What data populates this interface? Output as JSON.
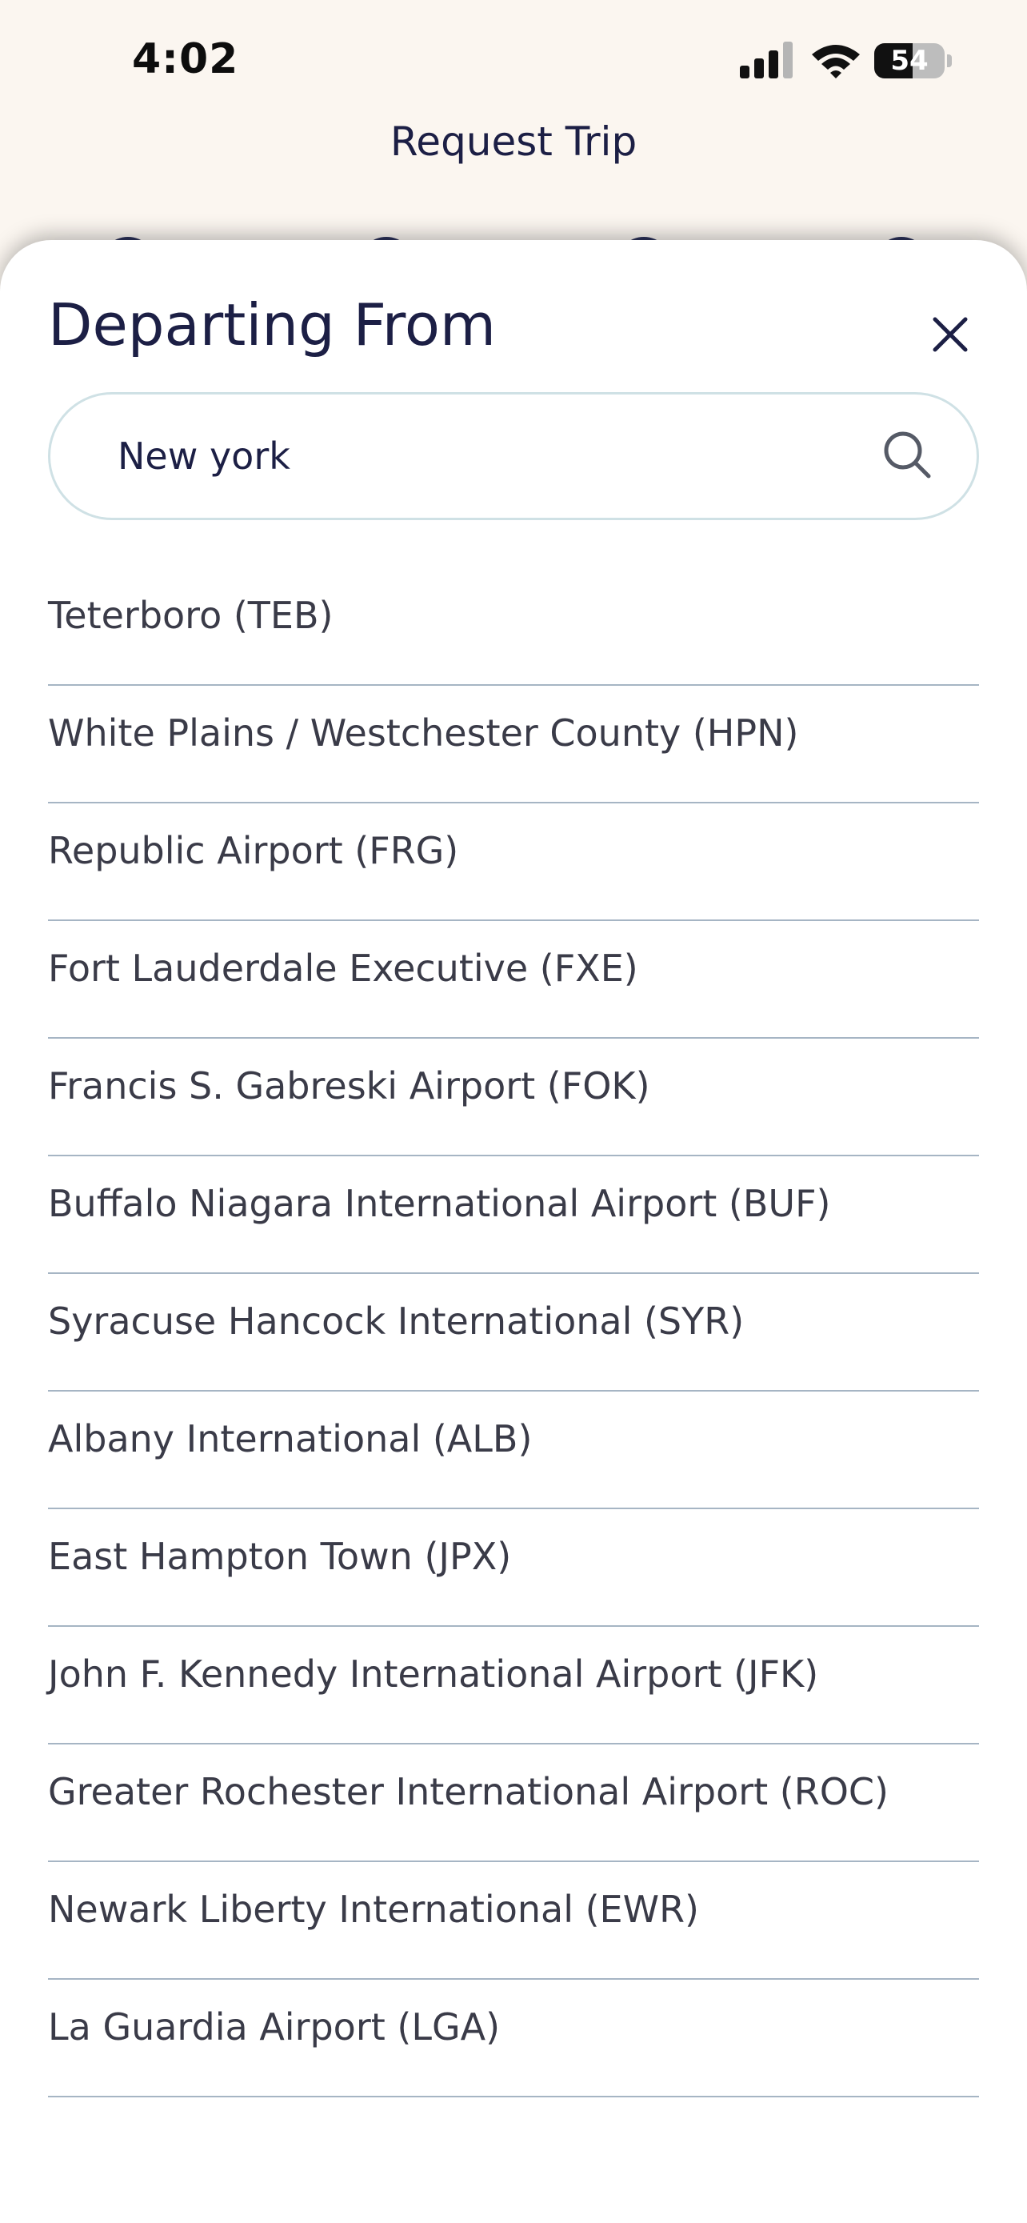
{
  "status_bar": {
    "time": "4:02",
    "battery_level": "54",
    "battery_fraction": 0.54,
    "icons": [
      "cellular-signal-icon",
      "wifi-icon",
      "battery-icon"
    ]
  },
  "page": {
    "title": "Request Trip"
  },
  "sheet": {
    "title": "Departing From",
    "close_icon": "close-icon",
    "search": {
      "value": "New york",
      "icon": "search-icon"
    },
    "results": [
      "Teterboro (TEB)",
      "White Plains / Westchester County (HPN)",
      "Republic Airport (FRG)",
      "Fort Lauderdale Executive (FXE)",
      "Francis S. Gabreski Airport (FOK)",
      "Buffalo Niagara International Airport (BUF)",
      "Syracuse Hancock International (SYR)",
      "Albany International (ALB)",
      "East Hampton Town (JPX)",
      "John F. Kennedy International Airport (JFK)",
      "Greater Rochester International Airport (ROC)",
      "Newark Liberty International (EWR)",
      "La Guardia Airport (LGA)"
    ]
  },
  "colors": {
    "background": "#fbf6f0",
    "navy": "#1c1f45",
    "divider": "#a6b5c4",
    "search_border": "#cfe1e5"
  }
}
